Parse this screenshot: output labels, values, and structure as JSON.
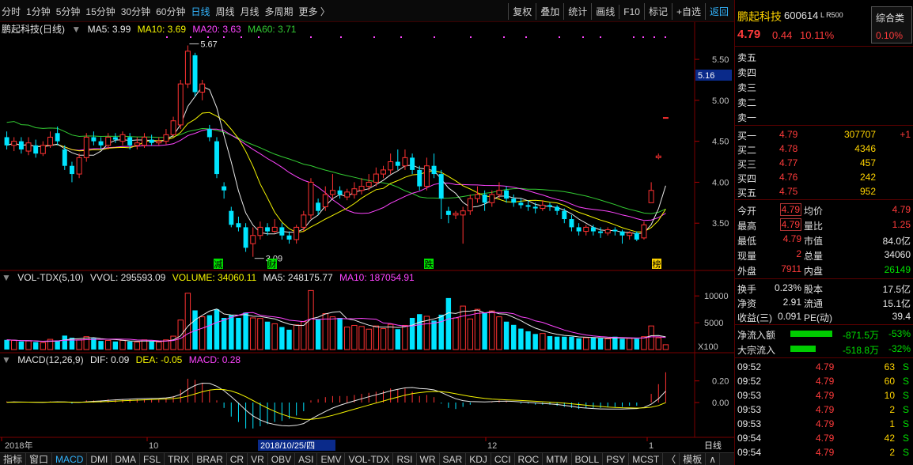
{
  "toolbar": {
    "periods": [
      "分时",
      "1分钟",
      "5分钟",
      "15分钟",
      "30分钟",
      "60分钟",
      "日线",
      "周线",
      "月线",
      "多周期",
      "更多 〉"
    ],
    "active_period": "日线",
    "buttons": [
      "复权",
      "叠加",
      "统计",
      "画线",
      "F10",
      "标记",
      "+自选",
      "返回"
    ]
  },
  "main_legend": {
    "stock_label": "鹏起科技(日线)",
    "ma5": "MA5: 3.99",
    "ma10": "MA10: 3.69",
    "ma20": "MA20: 3.63",
    "ma60": "MA60: 3.71",
    "ma5_color": "#e8e8e8",
    "ma10_color": "#f5f500",
    "ma20_color": "#ff44ff",
    "ma60_color": "#33cc33"
  },
  "price_axis": [
    "5.50",
    "5.00",
    "4.50",
    "4.00",
    "3.50"
  ],
  "current_price_tag": "5.16",
  "annotations": {
    "high": "5.67",
    "low": "3.09",
    "events": [
      "减",
      "财",
      "跌",
      "榜"
    ]
  },
  "vol_legend": {
    "name": "VOL-TDX(5,10)",
    "vvol": "VVOL: 295593.09",
    "volume": "VOLUME: 34060.11",
    "ma5": "MA5: 248175.77",
    "ma10": "MA10: 187054.91"
  },
  "vol_axis": [
    "10000",
    "5000"
  ],
  "vol_unit": "X100",
  "macd_legend": {
    "name": "MACD(12,26,9)",
    "dif": "DIF: 0.09",
    "dea": "DEA: -0.05",
    "macd": "MACD: 0.28"
  },
  "macd_axis": [
    "0.20",
    "0.00"
  ],
  "time_axis": {
    "labels": [
      "2018年",
      "10",
      "12",
      "1"
    ],
    "cursor_date": "2018/10/25/四",
    "period": "日线"
  },
  "bottom_tabs": [
    "指标",
    "窗口",
    "MACD",
    "DMI",
    "DMA",
    "FSL",
    "TRIX",
    "BRAR",
    "CR",
    "VR",
    "OBV",
    "ASI",
    "EMV",
    "VOL-TDX",
    "RSI",
    "WR",
    "SAR",
    "KDJ",
    "CCI",
    "ROC",
    "MTM",
    "BOLL",
    "PSY",
    "MCST",
    "〈",
    "模板",
    "∧"
  ],
  "active_bottom_tab": "MACD",
  "quote": {
    "name": "鹏起科技",
    "code": "600614",
    "tags": "L R500",
    "category_button": "综合类",
    "category_pct": "0.10%",
    "price": "4.79",
    "change": "0.44",
    "change_pct": "10.11%",
    "sell": [
      {
        "label": "卖五",
        "price": "",
        "vol": ""
      },
      {
        "label": "卖四",
        "price": "",
        "vol": ""
      },
      {
        "label": "卖三",
        "price": "",
        "vol": ""
      },
      {
        "label": "卖二",
        "price": "",
        "vol": ""
      },
      {
        "label": "卖一",
        "price": "",
        "vol": ""
      }
    ],
    "buy": [
      {
        "label": "买一",
        "price": "4.79",
        "vol": "307707",
        "chg": "+1"
      },
      {
        "label": "买二",
        "price": "4.78",
        "vol": "4346",
        "chg": ""
      },
      {
        "label": "买三",
        "price": "4.77",
        "vol": "457",
        "chg": ""
      },
      {
        "label": "买四",
        "price": "4.76",
        "vol": "242",
        "chg": ""
      },
      {
        "label": "买五",
        "price": "4.75",
        "vol": "952",
        "chg": ""
      }
    ],
    "stats": [
      {
        "l1": "今开",
        "v1": "4.79",
        "l2": "均价",
        "v2": "4.79",
        "box": true,
        "c1": "red",
        "c2": "red"
      },
      {
        "l1": "最高",
        "v1": "4.79",
        "l2": "量比",
        "v2": "1.25",
        "box": true,
        "c1": "red",
        "c2": "red"
      },
      {
        "l1": "最低",
        "v1": "4.79",
        "l2": "市值",
        "v2": "84.0亿",
        "box": false,
        "c1": "red",
        "c2": "wht"
      },
      {
        "l1": "现量",
        "v1": "2",
        "l2": "总量",
        "v2": "34060",
        "box": false,
        "c1": "red",
        "c2": "wht"
      },
      {
        "l1": "外盘",
        "v1": "7911",
        "l2": "内盘",
        "v2": "26149",
        "box": false,
        "c1": "red",
        "c2": "grn"
      }
    ],
    "stats2": [
      {
        "l1": "换手",
        "v1": "0.23%",
        "l2": "股本",
        "v2": "17.5亿"
      },
      {
        "l1": "净资",
        "v1": "2.91",
        "l2": "流通",
        "v2": "15.1亿"
      },
      {
        "l1": "收益(三)",
        "v1": "0.091",
        "l2": "PE(动)",
        "v2": "39.4"
      }
    ],
    "flows": [
      {
        "label": "净流入额",
        "value": "-871.5万",
        "pct": "-53%",
        "bar": 0.53
      },
      {
        "label": "大宗流入",
        "value": "-518.8万",
        "pct": "-32%",
        "bar": 0.32
      }
    ],
    "ticks": [
      {
        "time": "09:52",
        "price": "4.79",
        "vol": "63",
        "dir": "S"
      },
      {
        "time": "09:52",
        "price": "4.79",
        "vol": "60",
        "dir": "S"
      },
      {
        "time": "09:53",
        "price": "4.79",
        "vol": "10",
        "dir": "S"
      },
      {
        "time": "09:53",
        "price": "4.79",
        "vol": "2",
        "dir": "S"
      },
      {
        "time": "09:53",
        "price": "4.79",
        "vol": "1",
        "dir": "S"
      },
      {
        "time": "09:54",
        "price": "4.79",
        "vol": "42",
        "dir": "S"
      },
      {
        "time": "09:54",
        "price": "4.79",
        "vol": "2",
        "dir": "S"
      }
    ]
  },
  "chart_data": {
    "type": "candlestick",
    "ylim": [
      3.0,
      5.8
    ],
    "candles": [
      [
        4.55,
        4.45,
        4.62,
        4.4
      ],
      [
        4.45,
        4.5,
        4.55,
        4.38
      ],
      [
        4.5,
        4.4,
        4.55,
        4.35
      ],
      [
        4.38,
        4.48,
        4.55,
        4.33
      ],
      [
        4.45,
        4.35,
        4.52,
        4.3
      ],
      [
        4.35,
        4.45,
        4.5,
        4.32
      ],
      [
        4.45,
        4.55,
        4.62,
        4.42
      ],
      [
        4.6,
        4.5,
        4.68,
        4.45
      ],
      [
        4.4,
        4.2,
        4.45,
        4.15
      ],
      [
        4.2,
        4.1,
        4.25,
        4.0
      ],
      [
        4.1,
        4.3,
        4.35,
        4.05
      ],
      [
        4.3,
        4.55,
        4.6,
        4.25
      ],
      [
        4.55,
        4.5,
        4.62,
        4.45
      ],
      [
        4.5,
        4.45,
        4.55,
        4.4
      ],
      [
        4.45,
        4.55,
        4.6,
        4.4
      ],
      [
        4.55,
        4.52,
        4.6,
        4.48
      ],
      [
        4.5,
        4.58,
        4.62,
        4.45
      ],
      [
        4.55,
        4.45,
        4.6,
        4.4
      ],
      [
        4.45,
        4.48,
        4.55,
        4.4
      ],
      [
        4.45,
        4.55,
        4.6,
        4.42
      ],
      [
        4.52,
        4.48,
        4.58,
        4.45
      ],
      [
        4.48,
        4.5,
        4.55,
        4.45
      ],
      [
        4.5,
        4.58,
        4.65,
        4.46
      ],
      [
        4.58,
        4.75,
        4.8,
        4.55
      ],
      [
        4.7,
        5.2,
        5.25,
        4.65
      ],
      [
        5.2,
        5.6,
        5.67,
        5.15
      ],
      [
        5.55,
        5.1,
        5.58,
        5.05
      ],
      [
        5.1,
        5.2,
        5.25,
        5.0
      ],
      [
        4.65,
        4.55,
        4.7,
        4.5
      ],
      [
        4.5,
        4.1,
        4.55,
        4.05
      ],
      [
        3.95,
        3.9,
        4.0,
        3.8
      ],
      [
        3.65,
        3.48,
        3.7,
        3.45
      ],
      [
        3.5,
        3.45,
        3.58,
        3.4
      ],
      [
        3.45,
        3.2,
        3.5,
        3.15
      ],
      [
        3.25,
        3.35,
        3.45,
        3.09
      ],
      [
        3.35,
        3.45,
        3.52,
        3.3
      ],
      [
        3.45,
        3.4,
        3.5,
        3.35
      ],
      [
        3.4,
        3.45,
        3.55,
        3.38
      ],
      [
        3.45,
        3.35,
        3.5,
        3.3
      ],
      [
        3.35,
        3.3,
        3.4,
        3.25
      ],
      [
        3.3,
        3.45,
        3.48,
        3.25
      ],
      [
        3.45,
        3.6,
        3.65,
        3.4
      ],
      [
        3.6,
        4.0,
        4.05,
        3.55
      ],
      [
        3.75,
        3.65,
        3.8,
        3.6
      ],
      [
        3.7,
        3.85,
        3.95,
        3.65
      ],
      [
        3.85,
        3.9,
        4.1,
        3.8
      ],
      [
        3.9,
        3.85,
        3.95,
        3.8
      ],
      [
        3.82,
        3.88,
        3.92,
        3.78
      ],
      [
        3.85,
        3.92,
        4.0,
        3.8
      ],
      [
        3.9,
        3.95,
        4.05,
        3.85
      ],
      [
        3.95,
        4.0,
        4.1,
        3.9
      ],
      [
        4.0,
        4.1,
        4.18,
        3.95
      ],
      [
        4.1,
        4.15,
        4.2,
        4.05
      ],
      [
        4.15,
        4.25,
        4.35,
        4.1
      ],
      [
        4.25,
        4.2,
        4.4,
        4.15
      ],
      [
        4.2,
        4.3,
        4.4,
        4.15
      ],
      [
        4.3,
        4.15,
        4.35,
        4.1
      ],
      [
        4.15,
        3.95,
        4.2,
        3.9
      ],
      [
        3.95,
        4.2,
        4.3,
        3.9
      ],
      [
        4.2,
        4.1,
        4.35,
        4.05
      ],
      [
        4.1,
        3.8,
        4.15,
        3.55
      ],
      [
        3.65,
        3.6,
        3.7,
        3.5
      ],
      [
        3.6,
        3.62,
        3.65,
        3.55
      ],
      [
        3.6,
        3.65,
        3.7,
        3.25
      ],
      [
        3.65,
        3.8,
        3.85,
        3.6
      ],
      [
        3.8,
        3.85,
        3.95,
        3.75
      ],
      [
        3.85,
        3.75,
        3.9,
        3.65
      ],
      [
        3.75,
        3.85,
        3.9,
        3.7
      ],
      [
        3.85,
        3.9,
        4.0,
        3.8
      ],
      [
        3.9,
        3.8,
        3.95,
        3.75
      ],
      [
        3.8,
        3.75,
        3.85,
        3.7
      ],
      [
        3.75,
        3.72,
        3.8,
        3.68
      ],
      [
        3.72,
        3.7,
        3.78,
        3.65
      ],
      [
        3.7,
        3.68,
        3.75,
        3.62
      ],
      [
        3.68,
        3.72,
        3.78,
        3.65
      ],
      [
        3.72,
        3.7,
        3.75,
        3.65
      ],
      [
        3.7,
        3.65,
        3.72,
        3.6
      ],
      [
        3.65,
        3.55,
        3.68,
        3.5
      ],
      [
        3.55,
        3.45,
        3.6,
        3.4
      ],
      [
        3.45,
        3.4,
        3.5,
        3.35
      ],
      [
        3.4,
        3.45,
        3.48,
        3.35
      ],
      [
        3.45,
        3.4,
        3.48,
        3.35
      ],
      [
        3.4,
        3.38,
        3.45,
        3.32
      ],
      [
        3.38,
        3.42,
        3.45,
        3.35
      ],
      [
        3.42,
        3.4,
        3.45,
        3.35
      ],
      [
        3.4,
        3.35,
        3.42,
        3.25
      ],
      [
        3.35,
        3.38,
        3.4,
        3.3
      ],
      [
        3.38,
        3.3,
        3.4,
        3.28
      ],
      [
        3.32,
        3.48,
        3.52,
        3.3
      ],
      [
        3.75,
        3.9,
        4.0,
        3.75
      ],
      [
        4.3,
        4.32,
        4.35,
        4.28
      ],
      [
        4.79,
        4.79,
        4.79,
        4.79
      ]
    ],
    "volumes": [
      1800,
      1700,
      1500,
      1600,
      1400,
      1300,
      1900,
      1700,
      2600,
      2200,
      1800,
      2400,
      2100,
      1600,
      1700,
      1500,
      1700,
      1500,
      1400,
      1800,
      1500,
      1400,
      1800,
      2500,
      5500,
      10500,
      7300,
      6100,
      6400,
      7500,
      5900,
      6400,
      5900,
      6900,
      5900,
      5800,
      5200,
      4800,
      4200,
      3700,
      4600,
      5200,
      11000,
      5700,
      6700,
      6100,
      5900,
      4200,
      4500,
      4300,
      3800,
      4400,
      3900,
      4700,
      3800,
      4500,
      5900,
      6600,
      6200,
      5400,
      6500,
      9600,
      5900,
      8100,
      5700,
      7500,
      6900,
      7200,
      6100,
      5200,
      4600,
      3900,
      3400,
      2900,
      3000,
      2500,
      2400,
      2400,
      2400,
      2100,
      2200,
      2200,
      2100,
      2000,
      2400,
      2000,
      2100,
      2000,
      2400,
      4400,
      2200,
      900
    ],
    "macd": [
      0.01,
      0.01,
      0.0,
      0.0,
      0.0,
      0.0,
      0.01,
      0.01,
      0.0,
      -0.01,
      0.0,
      0.02,
      0.02,
      0.02,
      0.03,
      0.03,
      0.03,
      0.03,
      0.03,
      0.03,
      0.03,
      0.03,
      0.04,
      0.06,
      0.12,
      0.22,
      0.21,
      0.18,
      0.11,
      0.02,
      -0.05,
      -0.13,
      -0.18,
      -0.24,
      -0.24,
      -0.22,
      -0.2,
      -0.18,
      -0.17,
      -0.15,
      -0.12,
      -0.08,
      0.02,
      0.03,
      0.05,
      0.06,
      0.06,
      0.06,
      0.07,
      0.08,
      0.09,
      0.1,
      0.11,
      0.13,
      0.12,
      0.13,
      0.1,
      0.06,
      0.07,
      0.05,
      -0.01,
      -0.05,
      -0.06,
      -0.04,
      -0.02,
      0.0,
      0.0,
      0.01,
      0.02,
      0.01,
      0.0,
      -0.01,
      -0.01,
      -0.02,
      -0.02,
      -0.02,
      -0.03,
      -0.04,
      -0.05,
      -0.06,
      -0.05,
      -0.05,
      -0.05,
      -0.04,
      -0.04,
      -0.04,
      -0.03,
      -0.03,
      0.0,
      0.08,
      0.17,
      0.28
    ],
    "macd_ylim": [
      -0.3,
      0.3
    ]
  }
}
